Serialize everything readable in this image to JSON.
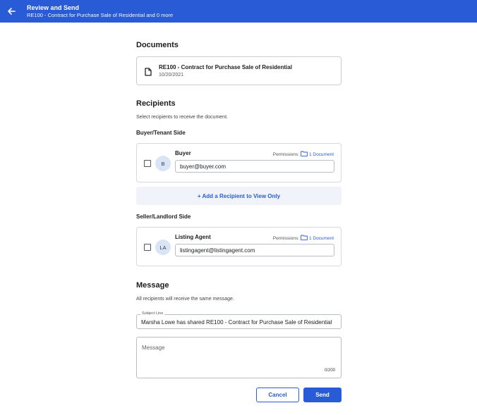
{
  "header": {
    "title": "Review and Send",
    "subtitle": "RE100 - Contract for Purchase Sale of Residential and 0 more",
    "back_icon": "arrow-left-icon"
  },
  "documents": {
    "heading": "Documents",
    "items": [
      {
        "title": "RE100 - Contract for Purchase Sale of Residential",
        "date": "10/20/2021",
        "icon": "document-icon"
      }
    ]
  },
  "recipients": {
    "heading": "Recipients",
    "description": "Select recipients to receive the document.",
    "buyer_side": {
      "label": "Buyer/Tenant Side",
      "recipient": {
        "initials": "B",
        "name": "Buyer",
        "permissions_label": "Permissions:",
        "permissions_value": "1 Document",
        "email": "buyer@buyer.com",
        "checked": false
      },
      "add_label": "+ Add a Recipient to View Only"
    },
    "seller_side": {
      "label": "Seller/Landlord Side",
      "recipient": {
        "initials": "LA",
        "name": "Listing Agent",
        "permissions_label": "Permissions:",
        "permissions_value": "1 Document",
        "email": "listingagent@listingagent.com",
        "checked": false
      }
    }
  },
  "message": {
    "heading": "Message",
    "description": "All recipients will receive the same message.",
    "subject_label": "Subject Line",
    "subject_value": "Marsha Lowe has shared RE100 - Contract for Purchase Sale of Residential",
    "body_placeholder": "Message",
    "counter": "0/200"
  },
  "actions": {
    "cancel_label": "Cancel",
    "send_label": "Send"
  },
  "colors": {
    "accent": "#2a5bd7",
    "avatar_bg": "#d9e4f5",
    "add_row_bg": "#f0f3f9"
  }
}
